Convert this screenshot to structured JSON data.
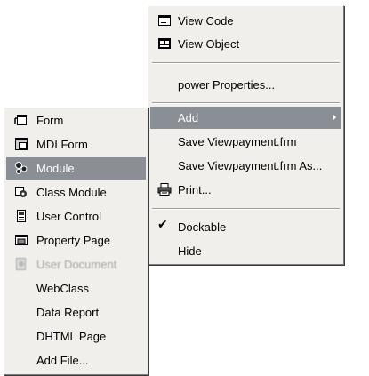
{
  "context_menu": {
    "items": [
      {
        "label": "View Code",
        "icon": "view-code-icon"
      },
      {
        "label": "View Object",
        "icon": "view-object-icon"
      },
      {
        "label": "power Properties..."
      },
      {
        "label": "Add",
        "has_submenu": true,
        "highlighted": true
      },
      {
        "label": "Save Viewpayment.frm"
      },
      {
        "label": "Save Viewpayment.frm As..."
      },
      {
        "label": "Print...",
        "icon": "printer-icon"
      },
      {
        "label": "Dockable",
        "checked": true,
        "check_glyph": "✔"
      },
      {
        "label": "Hide"
      }
    ]
  },
  "add_submenu": {
    "items": [
      {
        "label": "Form",
        "icon": "form-icon"
      },
      {
        "label": "MDI Form",
        "icon": "mdi-form-icon"
      },
      {
        "label": "Module",
        "icon": "module-icon",
        "highlighted": true
      },
      {
        "label": "Class Module",
        "icon": "class-module-icon"
      },
      {
        "label": "User Control",
        "icon": "user-control-icon"
      },
      {
        "label": "Property Page",
        "icon": "property-page-icon"
      },
      {
        "label": "User Document",
        "icon": "user-document-icon",
        "disabled": true
      },
      {
        "label": "WebClass"
      },
      {
        "label": "Data Report"
      },
      {
        "label": "DHTML Page"
      },
      {
        "label": "Add File..."
      }
    ]
  },
  "colors": {
    "menu_background": "#f0efeb",
    "highlight": "#8a8f95",
    "disabled_text": "#a7a7a7"
  }
}
